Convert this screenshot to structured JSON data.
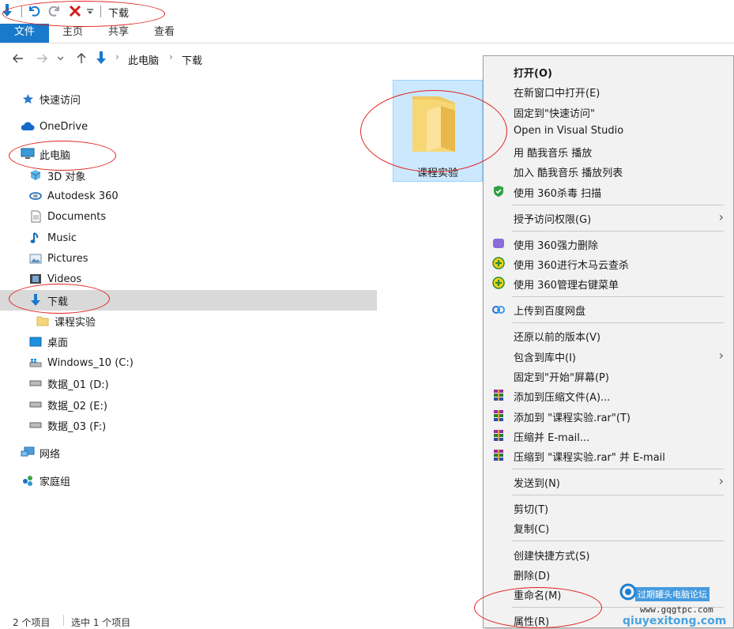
{
  "window": {
    "title": "下载"
  },
  "ribbon": {
    "tabs": [
      "文件",
      "主页",
      "共享",
      "查看"
    ]
  },
  "address": {
    "path": [
      "此电脑",
      "下载"
    ]
  },
  "nav_pane": {
    "items": [
      {
        "label": "快速访问",
        "icon": "star-icon"
      },
      {
        "label": "OneDrive",
        "icon": "cloud-icon"
      },
      {
        "label": "此电脑",
        "icon": "computer-icon"
      },
      {
        "label": "3D 对象",
        "icon": "cube-icon"
      },
      {
        "label": "Autodesk 360",
        "icon": "autodesk-icon"
      },
      {
        "label": "Documents",
        "icon": "document-icon"
      },
      {
        "label": "Music",
        "icon": "music-icon"
      },
      {
        "label": "Pictures",
        "icon": "pictures-icon"
      },
      {
        "label": "Videos",
        "icon": "video-icon"
      },
      {
        "label": "下载",
        "icon": "download-icon",
        "selected": true
      },
      {
        "label": "课程实验",
        "icon": "folder-icon"
      },
      {
        "label": "桌面",
        "icon": "desktop-icon"
      },
      {
        "label": "Windows_10 (C:)",
        "icon": "windows-drive-icon"
      },
      {
        "label": "数据_01 (D:)",
        "icon": "drive-icon"
      },
      {
        "label": "数据_02 (E:)",
        "icon": "drive-icon"
      },
      {
        "label": "数据_03 (F:)",
        "icon": "drive-icon"
      },
      {
        "label": "网络",
        "icon": "network-icon"
      },
      {
        "label": "家庭组",
        "icon": "homegroup-icon"
      }
    ]
  },
  "content": {
    "folder_name": "课程实验"
  },
  "context_menu": {
    "items": [
      {
        "label": "打开(O)",
        "bold": true
      },
      {
        "label": "在新窗口中打开(E)"
      },
      {
        "label": "固定到\"快速访问\""
      },
      {
        "label": "Open in Visual Studio"
      },
      {
        "label": "用 酷我音乐 播放"
      },
      {
        "label": "加入 酷我音乐 播放列表"
      },
      {
        "label": "使用 360杀毒 扫描",
        "icon": "shield-360-icon"
      },
      {
        "label": "授予访问权限(G)",
        "submenu": true
      },
      {
        "label": "使用 360强力删除",
        "icon": "purple-360-icon"
      },
      {
        "label": "使用 360进行木马云查杀",
        "icon": "green-360-icon"
      },
      {
        "label": "使用 360管理右键菜单",
        "icon": "green-360-icon"
      },
      {
        "label": "上传到百度网盘",
        "icon": "baidu-cloud-icon"
      },
      {
        "label": "还原以前的版本(V)"
      },
      {
        "label": "包含到库中(I)",
        "submenu": true
      },
      {
        "label": "固定到\"开始\"屏幕(P)"
      },
      {
        "label": "添加到压缩文件(A)...",
        "icon": "winrar-icon"
      },
      {
        "label": "添加到 \"课程实验.rar\"(T)",
        "icon": "winrar-icon"
      },
      {
        "label": "压缩并 E-mail...",
        "icon": "winrar-icon"
      },
      {
        "label": "压缩到 \"课程实验.rar\" 并 E-mail",
        "icon": "winrar-icon"
      },
      {
        "label": "发送到(N)",
        "submenu": true
      },
      {
        "label": "剪切(T)"
      },
      {
        "label": "复制(C)"
      },
      {
        "label": "创建快捷方式(S)"
      },
      {
        "label": "删除(D)"
      },
      {
        "label": "重命名(M)"
      },
      {
        "label": "属性(R)"
      }
    ]
  },
  "status_bar": {
    "item_count": "2 个项目",
    "selected": "选中 1 个项目"
  },
  "watermark": {
    "line1": "过期罐头电脑论坛",
    "line2": "www.gqgtpc.com",
    "line3": "qiuyexitong.com"
  },
  "colors": {
    "accent": "#1979ca",
    "selection": "#cce8ff",
    "annotation": "#e0201c",
    "menu_bg": "#f2f2f2"
  }
}
